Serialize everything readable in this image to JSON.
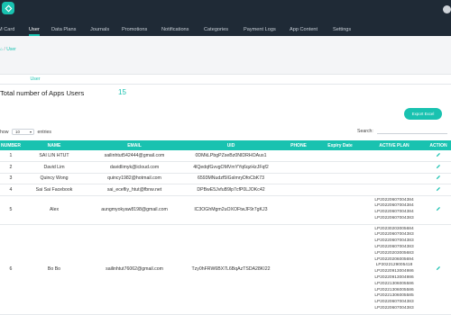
{
  "nav": {
    "items": [
      "M Card",
      "User",
      "Data Plans",
      "Journals",
      "Promotions",
      "Notifications",
      "Categories",
      "Payment Logs",
      "App Content",
      "Settings"
    ],
    "active_index": 1
  },
  "breadcrumb": {
    "home_icon": "home-icon",
    "separator": "/",
    "current": "User"
  },
  "tabs": {
    "active": "User"
  },
  "summary": {
    "label": "Total number of Apps Users",
    "count": "15"
  },
  "export_label": "Export Excel",
  "table_controls": {
    "show_label": "how",
    "page_size": "10",
    "entries_label": "entries",
    "search_label": "Search:"
  },
  "table": {
    "headers": [
      "NUMBER",
      "NAME",
      "EMAIL",
      "UID",
      "PHONE",
      "Expiry Date",
      "ACTIVE PLAN",
      "ACTION"
    ],
    "rows": [
      {
        "number": "1",
        "name": "SAI LIN HTUT",
        "email": "sailinhtut542444@gmail.com",
        "uid": "0DMkLPbgPZseBz0NIDRHOAus1",
        "phone": "",
        "expiry": "",
        "plans": []
      },
      {
        "number": "2",
        "name": "David Lim",
        "email": "davidlimyk@icloud.com",
        "uid": "4lQedqfGvvgOMVmYYq6qzHzJFqf2",
        "phone": "",
        "expiry": "",
        "plans": []
      },
      {
        "number": "3",
        "name": "Quincy Wong",
        "email": "quincy1982@hotmail.com",
        "uid": "6593MNudzf5IGslmryDfoCbK73",
        "phone": "",
        "expiry": "",
        "plans": []
      },
      {
        "number": "4",
        "name": "Sai Sai Facebook",
        "email": "sai_ecefliy_htut@fbnw.net",
        "uid": "DPBwE5JvfuB9lp7cfP0LJOKc42",
        "phone": "",
        "expiry": "",
        "plans": []
      },
      {
        "number": "5",
        "name": "Alex",
        "email": "aungmyokyaw8198@gmail.com",
        "uid": "lC3OGhMgm2uOXOFtwJF9r7gKJ3",
        "phone": "",
        "expiry": "",
        "plans": [
          "LP20220607004384",
          "LP20220607004384",
          "LP20220607004384",
          "LP20220607004383"
        ]
      },
      {
        "number": "6",
        "name": "Bo Bo",
        "email": "sailinhtut76062@gmail.com",
        "uid": "Tzy0hFRW6BX7L6BqAzTSDA28KI22",
        "phone": "",
        "expiry": "",
        "plans": [
          "LP20230203005684",
          "LP20220607004383",
          "LP20220607004383",
          "LP20220607004383",
          "LP20220203005683",
          "LP20220206005694",
          "LP2022129005418",
          "LP20220913004986",
          "LP20220913004986",
          "LP20221306005586",
          "LP20221306005586",
          "LP20221306005585",
          "LP20220607004383",
          "LP20220607004383"
        ]
      }
    ]
  },
  "colors": {
    "accent": "#19c2b0",
    "nav_bg": "#1f2a36"
  },
  "icons": {
    "logo": "app-logo-icon",
    "avatar": "user-avatar",
    "edit": "pencil-icon"
  }
}
